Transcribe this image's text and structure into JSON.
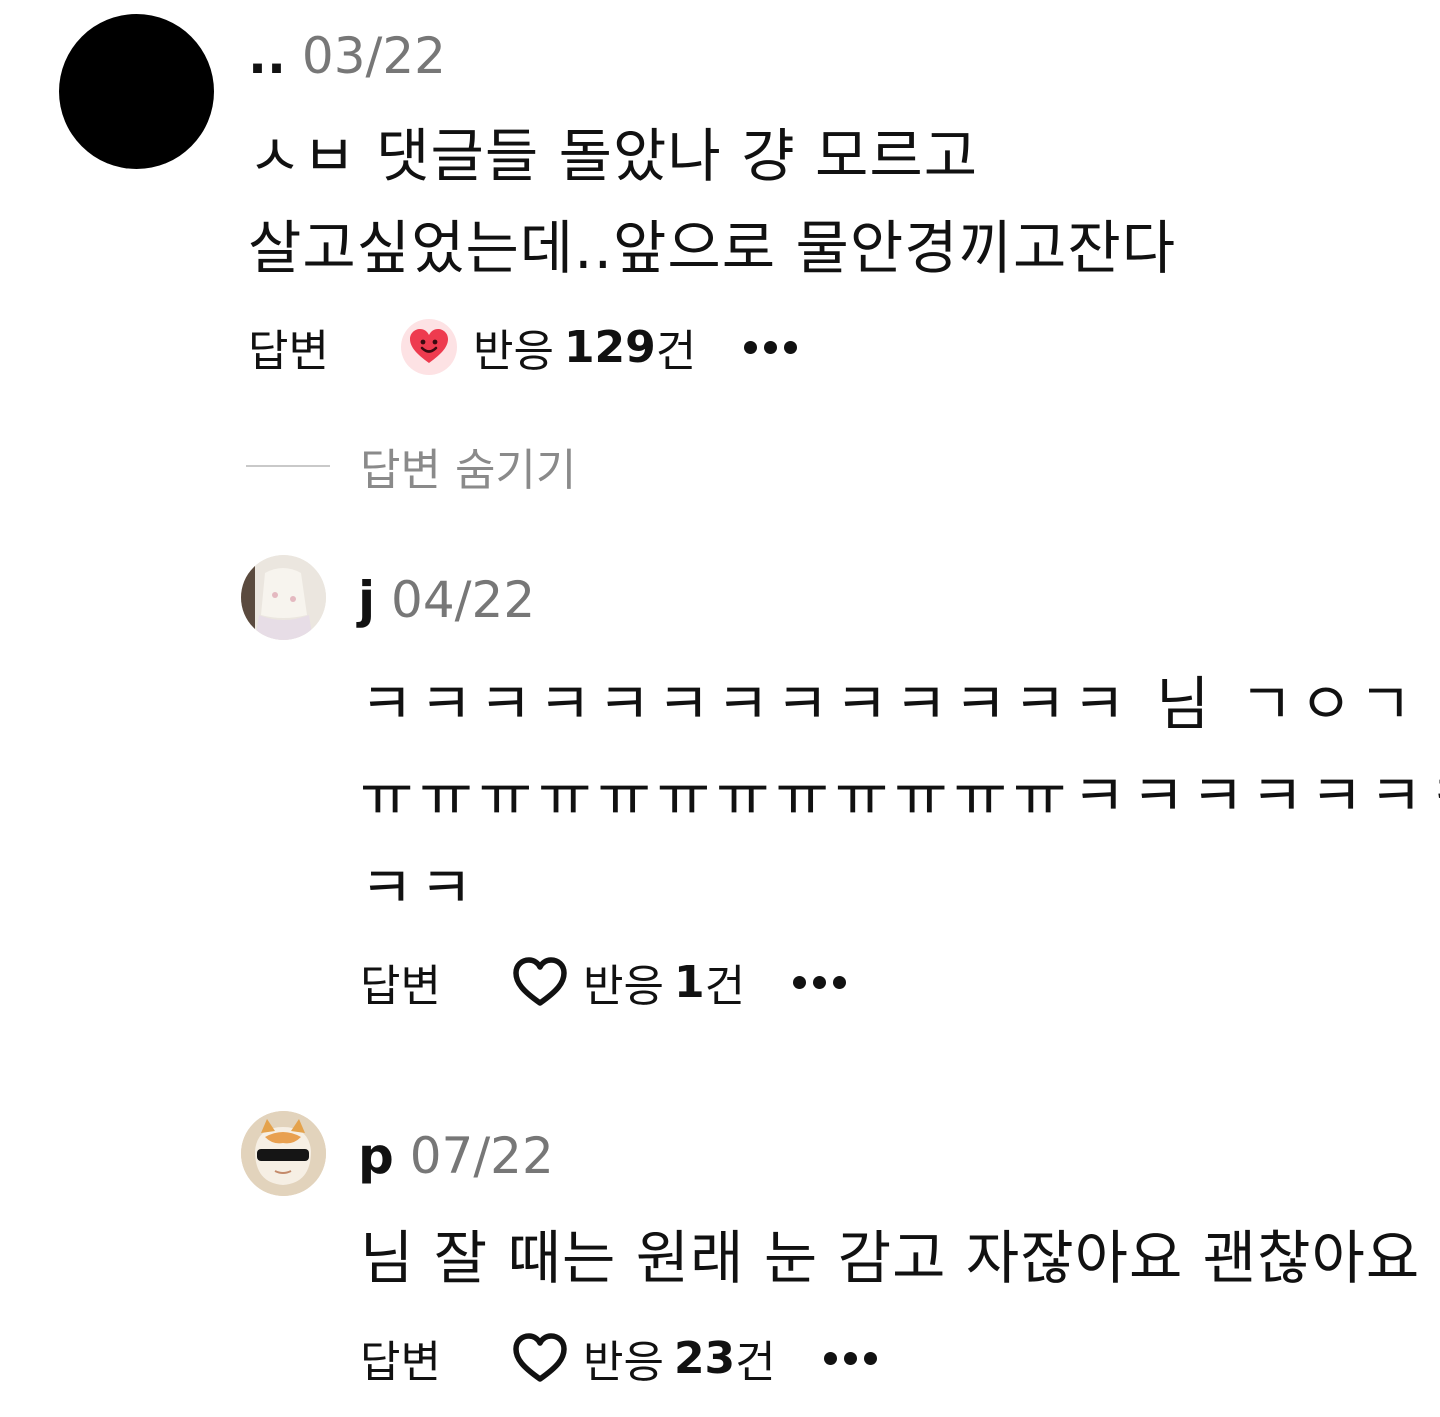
{
  "comment_main": {
    "username": "..",
    "date": "03/22",
    "text_line1": "ㅅㅂ 댓글들 돌았나 걍 모르고",
    "text_line2": "살고싶었는데..앞으로 물안경끼고잔다",
    "reply_label": "답변",
    "reaction_label": "반응",
    "reaction_count": "129",
    "reaction_unit": "건",
    "reaction_icon": "smiling-heart-icon"
  },
  "hide_replies_label": "답변 숨기기",
  "replies": [
    {
      "username": "j",
      "date": "04/22",
      "text_line1": "ㅋㅋㅋㅋㅋㅋㅋㅋㅋㅋㅋㅋㅋ 님 ㄱㅇㄱ",
      "text_line2": "ㅠㅠㅠㅠㅠㅠㅠㅠㅠㅠㅠㅠㅋㅋㅋㅋㅋㅋㅋ",
      "text_line3": "ㅋㅋ",
      "reply_label": "답변",
      "reaction_label": "반응",
      "reaction_count": "1",
      "reaction_unit": "건"
    },
    {
      "username": "p",
      "date": "07/22",
      "text_line1": "님 잘 때는 원래 눈 감고 자잖아요 괜찮아요",
      "reply_label": "답변",
      "reaction_label": "반응",
      "reaction_count": "23",
      "reaction_unit": "건"
    }
  ],
  "colors": {
    "text_primary": "#111111",
    "text_secondary": "#777777",
    "divider": "#c9c9c9",
    "reaction_bg": "#fde2e4",
    "heart_red": "#ee3b4f"
  }
}
